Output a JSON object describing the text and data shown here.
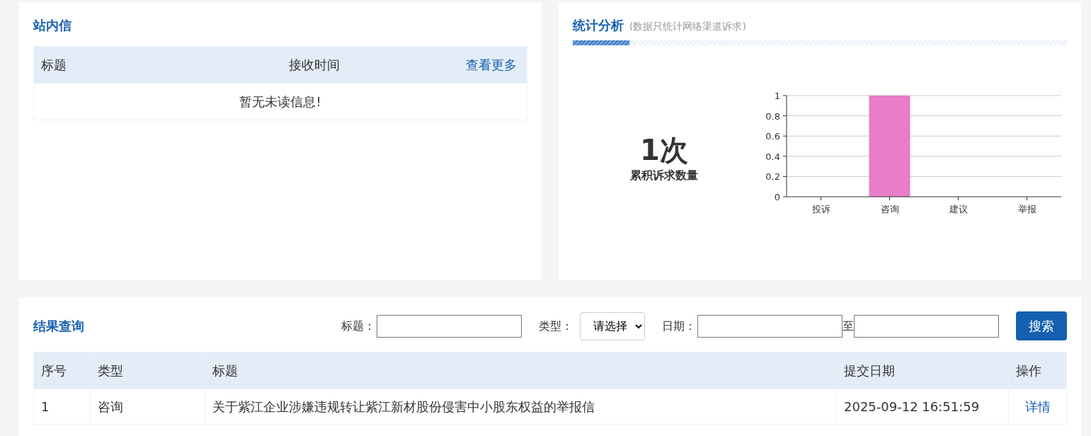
{
  "messages": {
    "title": "站内信",
    "columns": [
      "标题",
      "接收时间"
    ],
    "more_link": "查看更多",
    "empty_text": "暂无未读信息!"
  },
  "stats": {
    "title": "统计分析",
    "subtitle": "(数据只统计网络渠道诉求)",
    "total": "1次",
    "total_label": "累积诉求数量",
    "chart_data": {
      "type": "bar",
      "categories": [
        "投诉",
        "咨询",
        "建议",
        "举报"
      ],
      "series": [
        {
          "color": "#e87dc8",
          "values": [
            0,
            1,
            0,
            0
          ]
        }
      ],
      "grid": true,
      "ylim": [
        0,
        1
      ],
      "yticks": [
        0,
        0.2,
        0.4,
        0.6,
        0.8,
        1
      ]
    }
  },
  "results": {
    "title": "结果查询",
    "filters": [
      {
        "kind": "text",
        "label": "标题："
      },
      {
        "kind": "select",
        "label": "类型：",
        "value": "请选择"
      },
      {
        "kind": "daterange",
        "label": "日期：",
        "separator": "至"
      }
    ],
    "search_button": "搜索",
    "columns": [
      "序号",
      "类型",
      "标题",
      "提交日期",
      "操作"
    ],
    "rows": [
      {
        "cells": [
          "1",
          "咨询",
          "关于紫江企业涉嫌违规转让紫江新材股份侵害中小股东权益的举报信",
          "2025-09-12 16:51:59"
        ],
        "action": "详情"
      }
    ]
  }
}
